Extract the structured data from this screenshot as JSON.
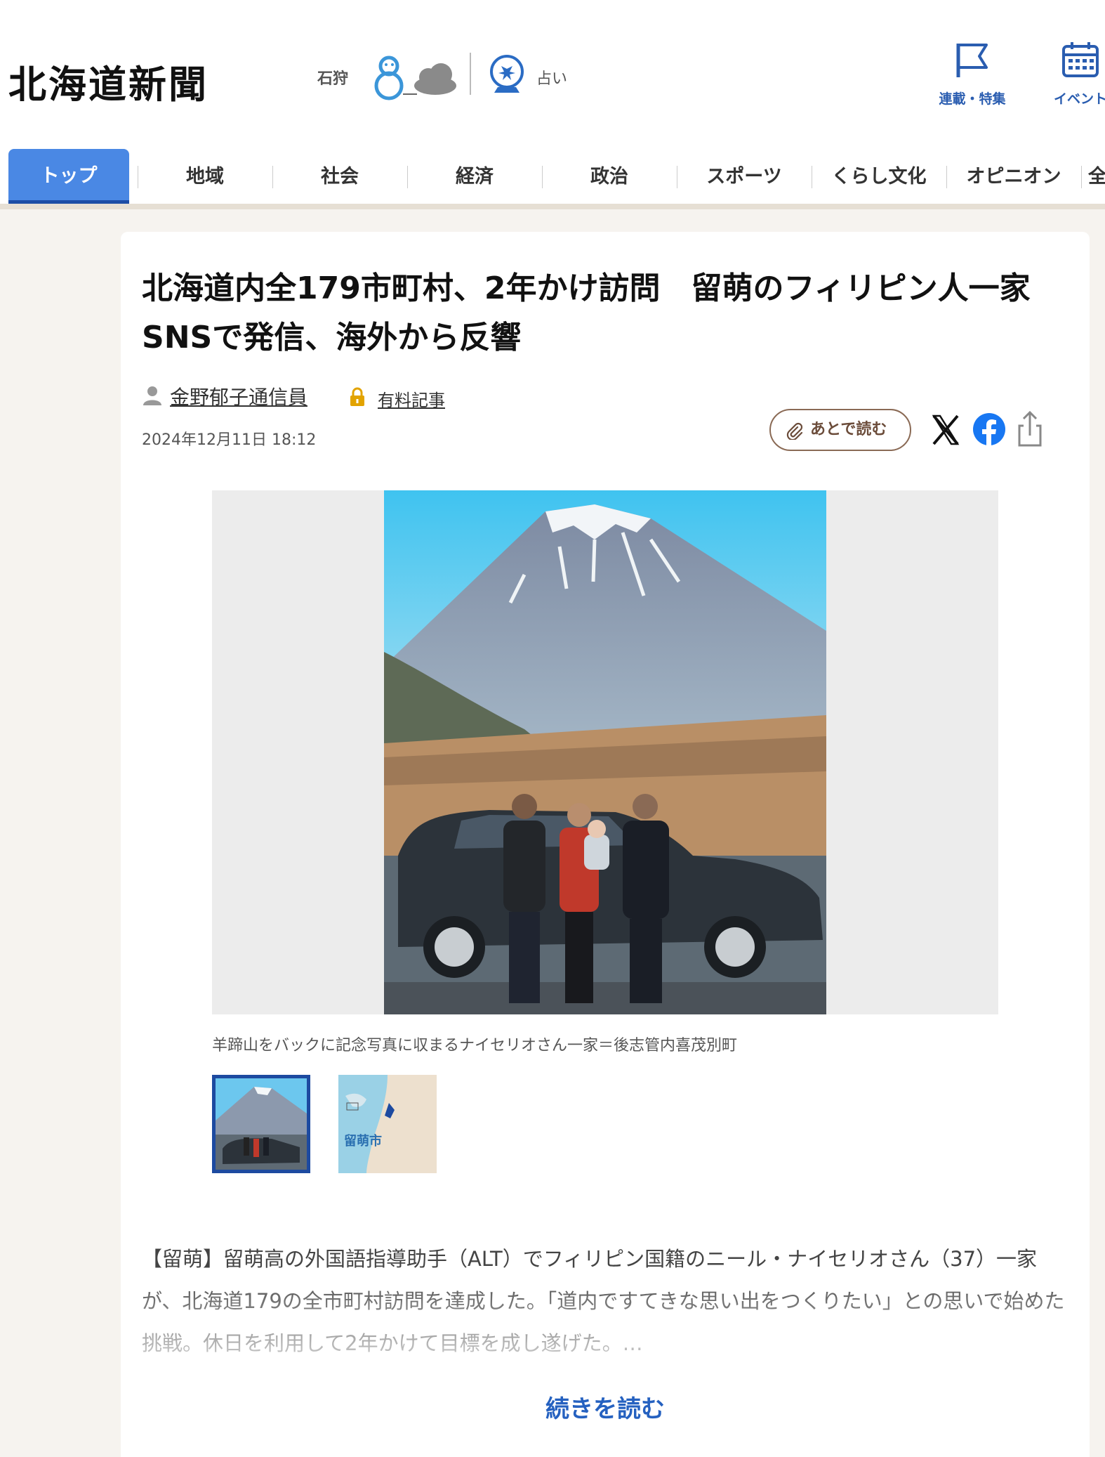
{
  "header": {
    "logo": "北海道新聞",
    "weather_location": "石狩",
    "weather_icons": [
      "snowman-icon",
      "cloud-icon"
    ],
    "fortune_label": "占い",
    "utility": [
      {
        "label": "連載・特集",
        "icon": "flag-icon"
      },
      {
        "label": "イベント",
        "icon": "calendar-icon"
      }
    ]
  },
  "nav": {
    "tabs": [
      "トップ",
      "地域",
      "社会",
      "経済",
      "政治",
      "スポーツ",
      "くらし文化",
      "オピニオン",
      "全"
    ],
    "active": "トップ"
  },
  "article": {
    "title": "北海道内全179市町村、2年かけ訪問　留萌のフィリピン人一家　SNSで発信、海外から反響",
    "author": "金野郁子通信員",
    "paid_label": "有料記事",
    "date": "2024年12月11日 18:12",
    "read_later_label": "あとで読む",
    "share_icons": [
      "x-icon",
      "facebook-icon",
      "share-icon"
    ],
    "caption": "羊蹄山をバックに記念写真に収まるナイセリオさん一家＝後志管内喜茂別町",
    "map_thumb_label": "留萌市",
    "body": "【留萌】留萌高の外国語指導助手（ALT）でフィリピン国籍のニール・ナイセリオさん（37）一家が、北海道179の全市町村訪問を達成した。「道内ですてきな思い出をつくりたい」との思いで始めた挑戦。休日を利用して2年かけて目標を成し遂げた。…",
    "read_more_label": "続きを読む"
  },
  "colors": {
    "accent": "#4a88e4",
    "accent_dark": "#1c4da6",
    "link": "#2561c0",
    "util_label": "#2a5db0",
    "page_bg": "#f6f3ef"
  }
}
